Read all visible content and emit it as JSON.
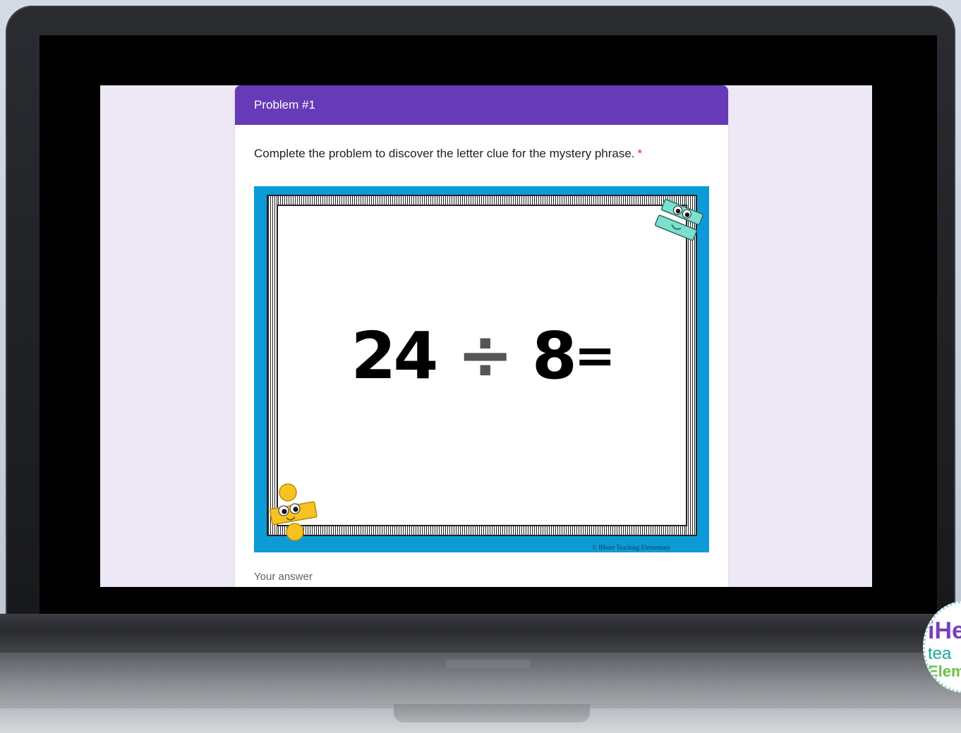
{
  "form": {
    "section_title": "Problem #1",
    "question": "Complete the problem to discover the letter clue for the mystery phrase.",
    "required_marker": "*",
    "answer_placeholder": "Your answer"
  },
  "problem_card": {
    "dividend": "24",
    "operator": "÷",
    "divisor": "8",
    "equals": "=",
    "copyright": "© IHeart Teaching Elementary"
  },
  "badge": {
    "line1": "iHe",
    "line2": "tea",
    "line3": "Elem"
  },
  "colors": {
    "header": "#673ab7",
    "background": "#ede7f6",
    "card_border": "#0d9bd7",
    "required": "#d93025"
  }
}
